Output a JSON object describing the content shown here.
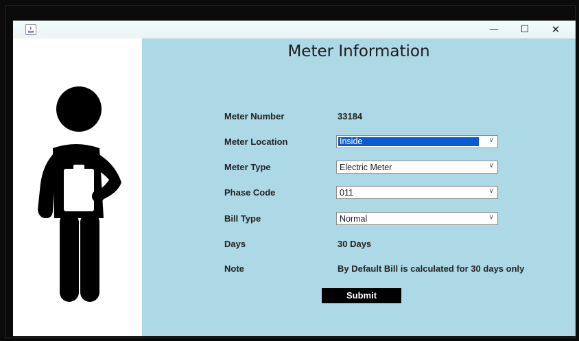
{
  "window": {
    "minimize": "—",
    "maximize": "☐",
    "close": "✕"
  },
  "form": {
    "title": "Meter Information",
    "meter_number": {
      "label": "Meter Number",
      "value": "33184"
    },
    "meter_location": {
      "label": "Meter Location",
      "selected": "Inside"
    },
    "meter_type": {
      "label": "Meter Type",
      "selected": "Electric Meter"
    },
    "phase_code": {
      "label": "Phase Code",
      "selected": "011"
    },
    "bill_type": {
      "label": "Bill Type",
      "selected": "Normal"
    },
    "days": {
      "label": "Days",
      "value": "30 Days"
    },
    "note": {
      "label": "Note",
      "value": "By Default Bill is calculated for 30 days only"
    },
    "submit_label": "Submit"
  },
  "colors": {
    "panel_bg": "#add8e6",
    "selection": "#0a5bd3",
    "button_bg": "#000000"
  },
  "icons": {
    "illustration": "person-with-clipboard-icon",
    "dropdown": "chevron-down-icon"
  }
}
